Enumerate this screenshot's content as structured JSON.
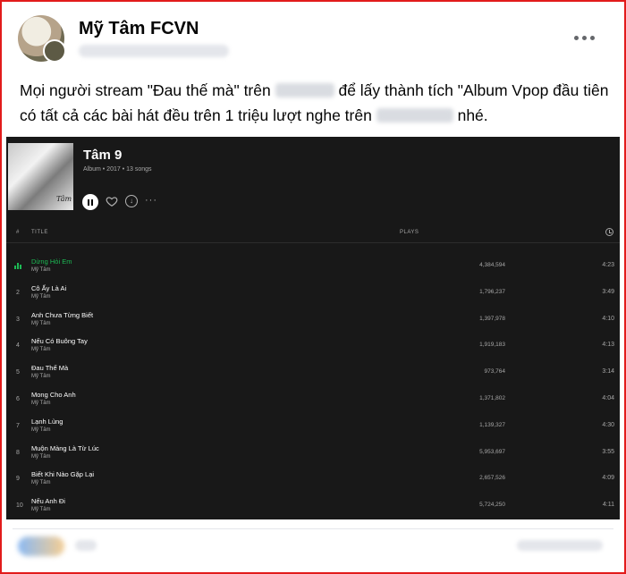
{
  "post": {
    "page_name": "Mỹ Tâm FCVN",
    "caption_part1": "Mọi người stream \"Đau thế mà\" trên",
    "caption_part2": "để lấy thành tích \"Album Vpop đầu tiên có tất cả các bài hát đều trên 1 triệu lượt nghe trên",
    "caption_part3": "nhé."
  },
  "album": {
    "title": "Tâm 9",
    "subtitle": "Album • 2017 • 13 songs",
    "cover_signature": "Tâm"
  },
  "table": {
    "col_num": "#",
    "col_title": "TITLE",
    "col_plays": "PLAYS"
  },
  "tracks": [
    {
      "num": "",
      "title": "Dừng Hỏi Em",
      "artist": "Mỹ Tâm",
      "plays": "4,384,594",
      "duration": "4:23",
      "active": true
    },
    {
      "num": "2",
      "title": "Cô Ấy Là Ai",
      "artist": "Mỹ Tâm",
      "plays": "1,796,237",
      "duration": "3:49"
    },
    {
      "num": "3",
      "title": "Anh Chưa Từng Biết",
      "artist": "Mỹ Tâm",
      "plays": "1,397,978",
      "duration": "4:10"
    },
    {
      "num": "4",
      "title": "Nếu Có Buông Tay",
      "artist": "Mỹ Tâm",
      "plays": "1,919,183",
      "duration": "4:13"
    },
    {
      "num": "5",
      "title": "Đau Thế Mà",
      "artist": "Mỹ Tâm",
      "plays": "973,764",
      "duration": "3:14"
    },
    {
      "num": "6",
      "title": "Mong Cho Anh",
      "artist": "Mỹ Tâm",
      "plays": "1,371,802",
      "duration": "4:04"
    },
    {
      "num": "7",
      "title": "Lạnh Lùng",
      "artist": "Mỹ Tâm",
      "plays": "1,139,327",
      "duration": "4:30"
    },
    {
      "num": "8",
      "title": "Muộn Màng Là Từ Lúc",
      "artist": "Mỹ Tâm",
      "plays": "5,953,697",
      "duration": "3:55"
    },
    {
      "num": "9",
      "title": "Biết Khi Nào Gặp Lại",
      "artist": "Mỹ Tâm",
      "plays": "2,657,526",
      "duration": "4:09"
    },
    {
      "num": "10",
      "title": "Nếu Anh Đi",
      "artist": "Mỹ Tâm",
      "plays": "5,724,250",
      "duration": "4:11"
    }
  ],
  "icons": {
    "more": "more-horizontal-icon",
    "play_pause": "pause-icon",
    "like": "heart-icon",
    "download": "download-icon",
    "clock": "clock-icon",
    "playing": "equalizer-icon"
  },
  "colors": {
    "frame_border": "#e21b1b",
    "spotify_bg": "#181818",
    "spotify_green": "#1db954"
  }
}
